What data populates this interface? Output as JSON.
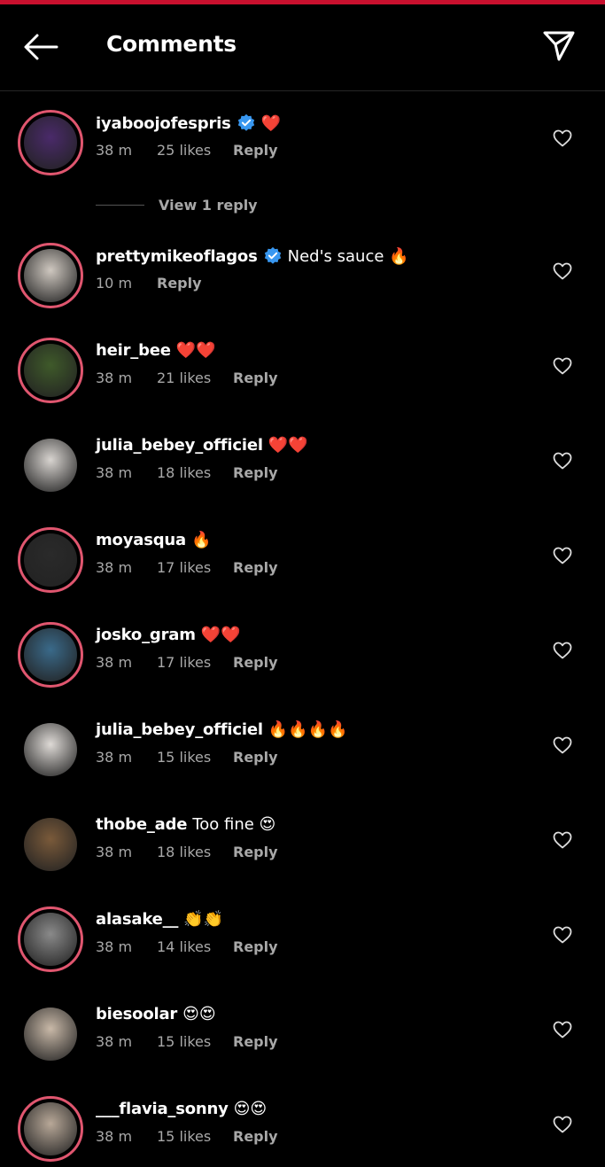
{
  "header": {
    "title": "Comments",
    "back_icon": "arrow-left-icon",
    "send_icon": "paper-plane-icon",
    "accent_top": "#c8102e"
  },
  "comments": [
    {
      "username": "iyaboojofespris",
      "verified": true,
      "text": "❤️",
      "time": "38 m",
      "likes": "25 likes",
      "reply": "Reply",
      "ring": true,
      "avatar_color": "#4a2a6a"
    },
    {
      "username": "prettymikeoflagos",
      "verified": true,
      "text": "Ned's sauce 🔥",
      "time": "10 m",
      "likes": "",
      "reply": "Reply",
      "ring": true,
      "avatar_color": "#cfc8c0"
    },
    {
      "username": "heir_bee",
      "verified": false,
      "text": "❤️❤️",
      "time": "38 m",
      "likes": "21 likes",
      "reply": "Reply",
      "ring": true,
      "avatar_color": "#3f5a2a"
    },
    {
      "username": "julia_bebey_officiel",
      "verified": false,
      "text": "❤️❤️",
      "time": "38 m",
      "likes": "18 likes",
      "reply": "Reply",
      "ring": false,
      "avatar_color": "#d8d4d0"
    },
    {
      "username": "moyasqua",
      "verified": false,
      "text": "🔥",
      "time": "38 m",
      "likes": "17 likes",
      "reply": "Reply",
      "ring": true,
      "avatar_color": "#2a2a2a"
    },
    {
      "username": "josko_gram",
      "verified": false,
      "text": "❤️❤️",
      "time": "38 m",
      "likes": "17 likes",
      "reply": "Reply",
      "ring": true,
      "avatar_color": "#3a6a8a"
    },
    {
      "username": "julia_bebey_officiel",
      "verified": false,
      "text": "🔥🔥🔥🔥",
      "time": "38 m",
      "likes": "15 likes",
      "reply": "Reply",
      "ring": false,
      "avatar_color": "#dedad6"
    },
    {
      "username": "thobe_ade",
      "verified": false,
      "text": "Too fine 😍",
      "time": "38 m",
      "likes": "18 likes",
      "reply": "Reply",
      "ring": false,
      "avatar_color": "#7a5a3a"
    },
    {
      "username": "alasake__",
      "verified": false,
      "text": "👏👏",
      "time": "38 m",
      "likes": "14 likes",
      "reply": "Reply",
      "ring": true,
      "avatar_color": "#8a8a8a"
    },
    {
      "username": "biesoolar",
      "verified": false,
      "text": "😍😍",
      "time": "38 m",
      "likes": "15 likes",
      "reply": "Reply",
      "ring": false,
      "avatar_color": "#c9b9a8"
    },
    {
      "username": "___flavia_sonny",
      "verified": false,
      "text": "😍😍",
      "time": "38 m",
      "likes": "15 likes",
      "reply": "Reply",
      "ring": true,
      "avatar_color": "#b8a898"
    }
  ],
  "view_replies": "View 1 reply",
  "colors": {
    "ring": "#e0566f",
    "meta": "#a8a8a8",
    "verified": "#3897f0"
  }
}
